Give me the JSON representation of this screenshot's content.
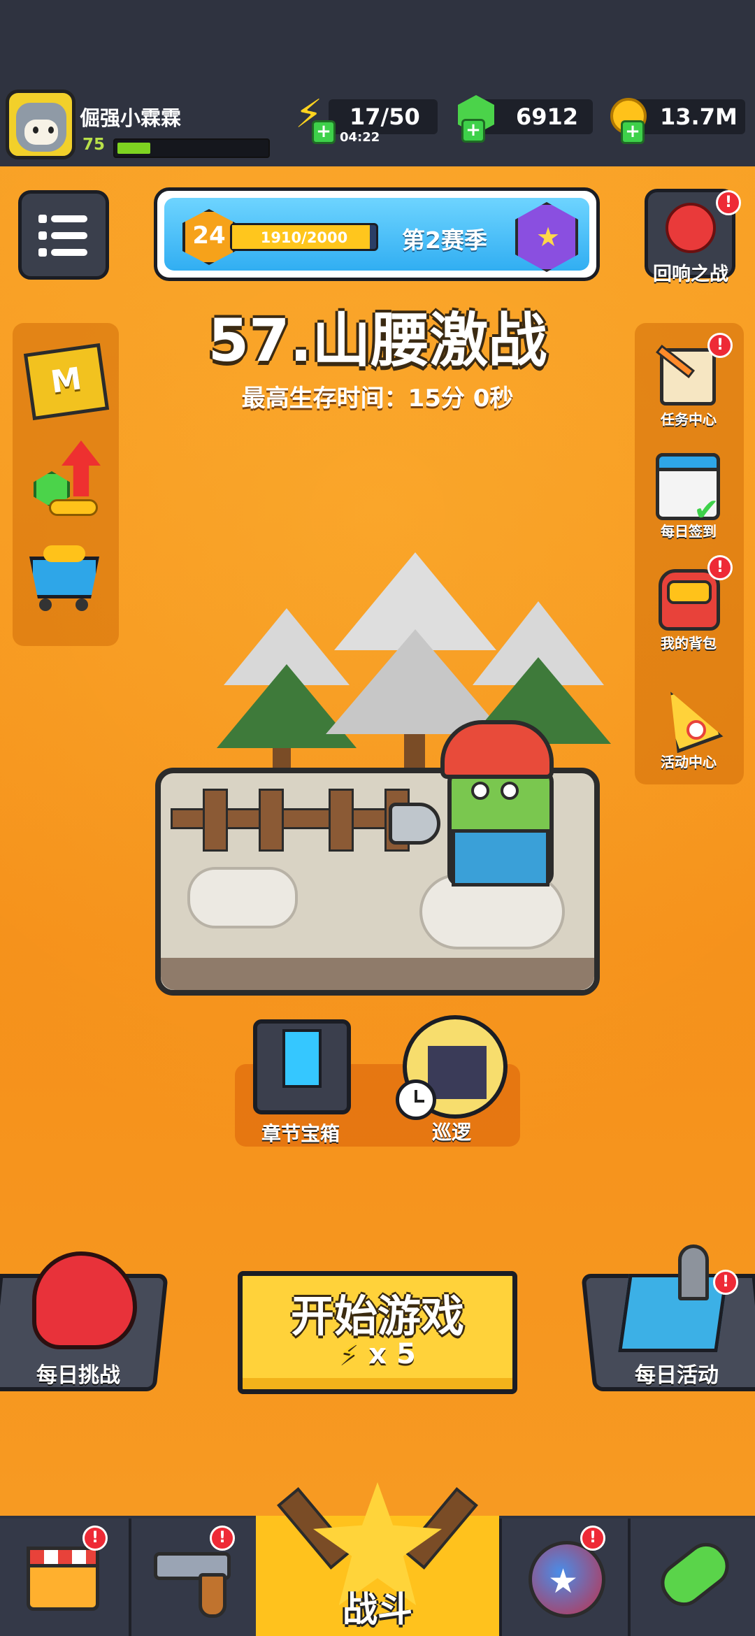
{
  "player": {
    "name": "倔强小霖霖",
    "level": "75",
    "xp_fraction": 0.22
  },
  "resources": {
    "energy": "17/50",
    "energy_timer": "04:22",
    "gems": "6912",
    "coins": "13.7M"
  },
  "season": {
    "level": "24",
    "progress_text": "1910/2000",
    "progress_fraction": 0.955,
    "label": "第2赛季"
  },
  "event_button": {
    "label": "回响之战",
    "badge": "!"
  },
  "stage": {
    "title": "57.山腰激战",
    "best_survival": "最高生存时间：15分 0秒"
  },
  "left_sidebar": [
    {
      "name": "m-card-icon"
    },
    {
      "name": "upgrade-arrow-icon"
    },
    {
      "name": "shop-cart-icon"
    }
  ],
  "right_sidebar": [
    {
      "label": "任务中心",
      "icon": "task-scroll-icon",
      "badge": "!"
    },
    {
      "label": "每日签到",
      "icon": "calendar-icon",
      "badge": ""
    },
    {
      "label": "我的背包",
      "icon": "backpack-icon",
      "badge": "!"
    },
    {
      "label": "活动中心",
      "icon": "party-horn-icon",
      "badge": ""
    }
  ],
  "chapter_chest": {
    "label": "章节宝箱"
  },
  "patrol": {
    "label": "巡逻"
  },
  "daily_challenge": {
    "label": "每日挑战"
  },
  "daily_event": {
    "label": "每日活动",
    "badge": "!"
  },
  "start_button": {
    "title": "开始游戏",
    "cost": "x 5"
  },
  "bottom_nav": {
    "battle_label": "战斗",
    "tabs": [
      {
        "icon": "store-icon",
        "badge": "!"
      },
      {
        "icon": "revolver-icon",
        "badge": "!"
      },
      {
        "icon": "battle-star-icon",
        "badge": ""
      },
      {
        "icon": "star-planet-icon",
        "badge": "!"
      },
      {
        "icon": "dna-capsule-icon",
        "badge": ""
      }
    ]
  },
  "colors": {
    "background_orange": "#f7941d",
    "bar_dark": "#2f3340",
    "start_yellow": "#ffd23a",
    "badge_red": "#ee2a36",
    "gem_green": "#4bd34a"
  }
}
